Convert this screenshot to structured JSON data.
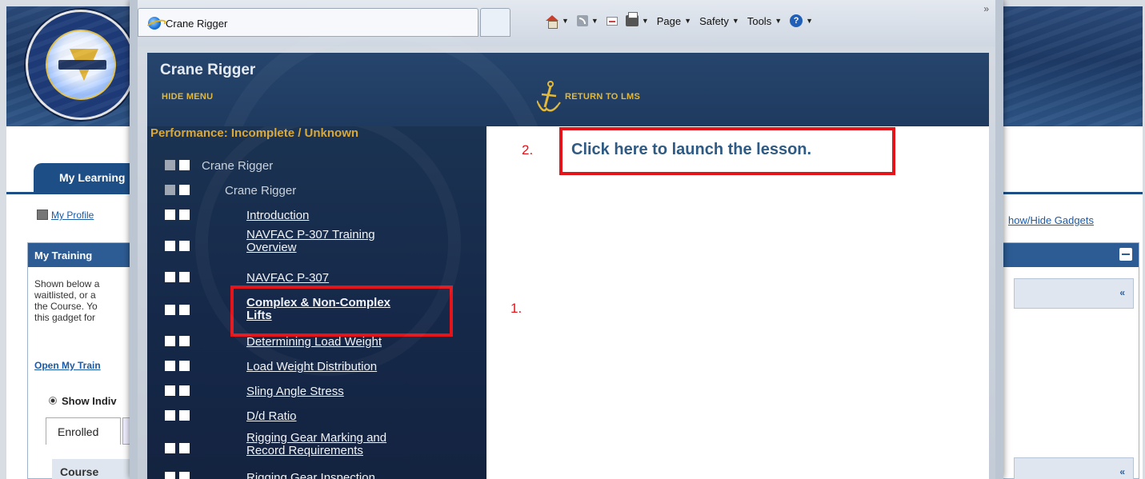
{
  "background_page": {
    "tab_label": "My Learning",
    "my_profile": "My Profile",
    "show_hide_gadgets": "how/Hide Gadgets",
    "gadget_title": "My Training",
    "gadget_text": [
      "Shown below a",
      "waitlisted, or a",
      "the Course. Yo",
      "this gadget for"
    ],
    "open_link": "Open My Train",
    "radio_label": "Show Indiv",
    "enrolled_tab": "Enrolled",
    "course_column": "Course",
    "collapse": "«"
  },
  "browser": {
    "tab_title": "Crane Rigger",
    "toolbar": {
      "page": "Page",
      "safety": "Safety",
      "tools": "Tools",
      "more": "»"
    }
  },
  "course": {
    "title": "Crane Rigger",
    "hide_menu": "HIDE MENU",
    "return_lms": "RETURN TO LMS",
    "performance": "Performance: Incomplete / Unknown",
    "launch_text": "Click here to launch the lesson.",
    "step1": "1.",
    "step2": "2.",
    "menu": [
      {
        "label": "Crane Rigger",
        "type": "root"
      },
      {
        "label": "Crane Rigger",
        "type": "module"
      },
      {
        "label": "Introduction",
        "type": "lesson"
      },
      {
        "label": "NAVFAC P-307 Training Overview",
        "line1": "NAVFAC P-307 Training",
        "line2": "Overview",
        "type": "lesson"
      },
      {
        "label": "NAVFAC P-307",
        "type": "lesson"
      },
      {
        "label": "Complex & Non-Complex Lifts",
        "line1": "Complex & Non-Complex",
        "line2": "Lifts",
        "type": "lesson-active"
      },
      {
        "label": "Determining Load Weight",
        "type": "lesson"
      },
      {
        "label": "Load Weight Distribution",
        "type": "lesson"
      },
      {
        "label": "Sling Angle Stress",
        "type": "lesson"
      },
      {
        "label": "D/d Ratio",
        "type": "lesson"
      },
      {
        "label": "Rigging Gear Marking and Record Requirements",
        "line1": "Rigging Gear Marking and",
        "line2": "Record Requirements",
        "type": "lesson"
      },
      {
        "label": "Rigging Gear Inspection",
        "type": "lesson"
      }
    ]
  },
  "colors": {
    "highlight": "#e4141b",
    "menu_bg": "#16294a",
    "gold": "#e2b93b",
    "link_blue": "#2f5a83"
  }
}
